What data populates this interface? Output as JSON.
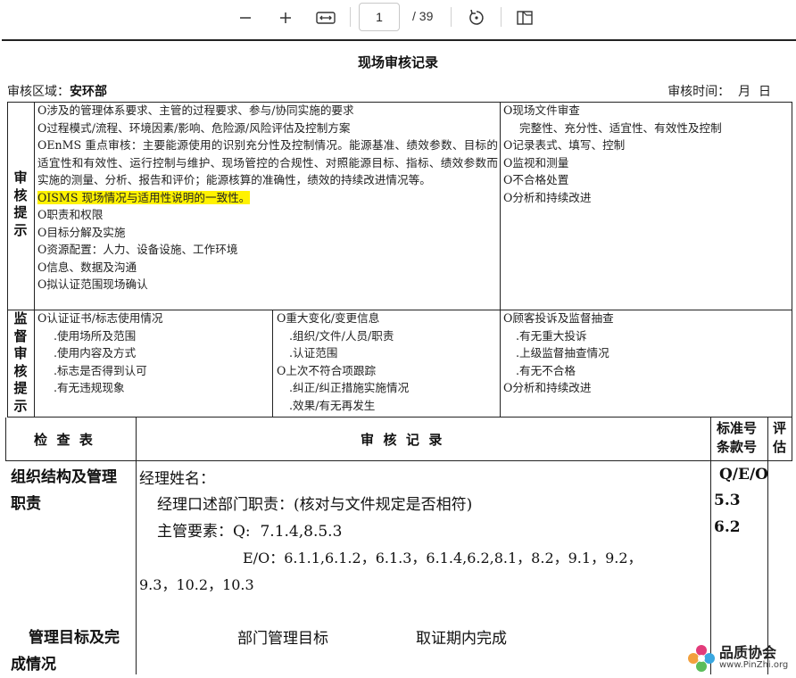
{
  "toolbar": {
    "zoom_out_icon": "minus-icon",
    "zoom_in_icon": "plus-icon",
    "fit_icon": "fit-width-icon",
    "page_current": "1",
    "page_total": "/ 39",
    "rotate_icon": "rotate-icon",
    "view_icon": "page-view-icon"
  },
  "doc": {
    "title": "现场审核记录",
    "area_label": "审核区域：",
    "area_value": "安环部",
    "time_label": "审核时间：  月  日"
  },
  "review": {
    "side_label": [
      "审",
      "核",
      "提",
      "示"
    ],
    "left_items": [
      "O涉及的管理体系要求、主管的过程要求、参与/协同实施的要求",
      "O过程模式/流程、环境因素/影响、危险源/风险评估及控制方案",
      "OEnMS 重点审核：主要能源使用的识别充分性及控制情况。能源基准、绩效参数、目标的适宜性和有效性、运行控制与维护、现场管控的合规性、对照能源目标、指标、绩效参数而实施的测量、分析、报告和评价；能源核算的准确性，绩效的持续改进情况等。",
      "OISMS 现场情况与适用性说明的一致性。",
      "O职责和权限",
      "O目标分解及实施",
      "O资源配置：人力、设备设施、工作环境",
      "O信息、数据及沟通",
      "O拟认证范围现场确认"
    ],
    "right_items": [
      "O现场文件审查",
      "完整性、充分性、适宜性、有效性及控制",
      "O记录表式、填写、控制",
      "O监视和测量",
      "O不合格处置",
      "O分析和持续改进"
    ]
  },
  "supervision": {
    "side_label": [
      "监",
      "督",
      "审",
      "核",
      "提",
      "示"
    ],
    "col1": [
      "O认证证书/标志使用情况",
      ".使用场所及范围",
      ".使用内容及方式",
      ".标志是否得到认可",
      ".有无违规现象"
    ],
    "col2": [
      "O重大变化/变更信息",
      ".组织/文件/人员/职责",
      ".认证范围",
      "O上次不符合项跟踪",
      ".纠正/纠正措施实施情况",
      ".效果/有无再发生"
    ],
    "col3": [
      "O顾客投诉及监督抽查",
      ".有无重大投诉",
      ".上级监督抽查情况",
      ".有无不合格",
      "O分析和持续改进"
    ]
  },
  "table": {
    "col_check": "检  查  表",
    "col_record": "审  核  记  录",
    "col_std_1": "标准号",
    "col_std_2": "条款号",
    "col_eval_1": "评",
    "col_eval_2": "估",
    "row1_item_1": "组织结构及管理",
    "row1_item_2": "职责",
    "manager_name": "经理姓名：",
    "duty_line": "经理口述部门职责：(核对与文件规定是否相符)",
    "main_req": "主管要素：Q:  7.1.4,8.5.3",
    "eo_line1": "E/O：6.1.1,6.1.2，6.1.3，6.1.4,6.2,8.1，8.2，9.1，9.2，",
    "eo_line2": "9.3，10.2，10.3",
    "std1": "Q/E/O",
    "std2": "5.3",
    "std3": "6.2",
    "row2_item_1": "管理目标及完",
    "row2_item_2": "成情况",
    "goal_text": "部门管理目标",
    "goal_status": "取证期内完成"
  },
  "watermark": {
    "brand": "品质协会",
    "url": "www.PinZhi.org"
  }
}
